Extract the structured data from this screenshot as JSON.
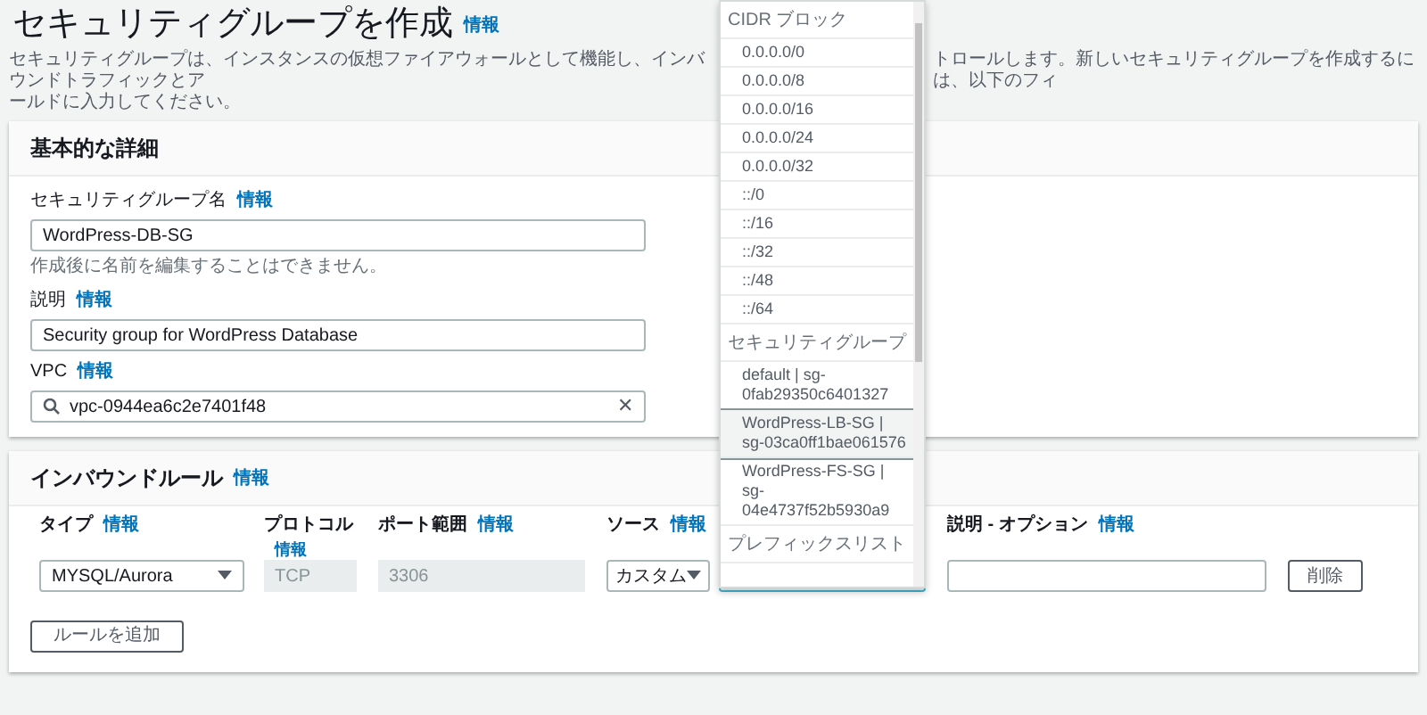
{
  "page": {
    "title": "セキュリティグループを作成",
    "title_info": "情報",
    "description_visible_start": "セキュリティグループは、インスタンスの仮想ファイアウォールとして機能し、インバウンドトラフィックとア",
    "description_visible_end": "トロールします。新しいセキュリティグループを作成するには、以下のフィ",
    "description_line_2": "ールドに入力してください。"
  },
  "basic_details": {
    "heading": "基本的な詳細",
    "fields": [
      {
        "kind": "text",
        "label": "セキュリティグループ名",
        "info": "情報",
        "value": "WordPress-DB-SG",
        "hint": "作成後に名前を編集することはできません。"
      },
      {
        "kind": "text",
        "label": "説明",
        "info": "情報",
        "value": "Security group for WordPress Database"
      },
      {
        "kind": "search",
        "label": "VPC",
        "info": "情報",
        "value": "vpc-0944ea6c2e7401f48",
        "clear": "✕"
      }
    ]
  },
  "inbound_rules": {
    "heading": "インバウンドルール",
    "info": "情報",
    "columns": [
      {
        "label": "タイプ",
        "info": "情報"
      },
      {
        "label": "プロトコル",
        "info": "情報",
        "info_below": true
      },
      {
        "label": "ポート範囲",
        "info": "情報"
      },
      {
        "label": "ソース",
        "info": "情報"
      },
      {
        "label": "説明 - オプション",
        "info": "情報"
      }
    ],
    "rows": [
      {
        "type": "MYSQL/Aurora",
        "protocol": "TCP",
        "port": "3306",
        "source": "カスタム",
        "delete": "削除"
      }
    ],
    "add_button": "ルールを追加"
  },
  "source_dropdown": {
    "groups": [
      {
        "label": "CIDR ブロック",
        "items": [
          {
            "text": "0.0.0.0/0",
            "selected": false
          },
          {
            "text": "0.0.0.0/8",
            "selected": false
          },
          {
            "text": "0.0.0.0/16",
            "selected": false
          },
          {
            "text": "0.0.0.0/24",
            "selected": false
          },
          {
            "text": "0.0.0.0/32",
            "selected": false
          },
          {
            "text": "::/0",
            "selected": false
          },
          {
            "text": "::/16",
            "selected": false
          },
          {
            "text": "::/32",
            "selected": false
          },
          {
            "text": "::/48",
            "selected": false
          },
          {
            "text": "::/64",
            "selected": false
          }
        ]
      },
      {
        "label": "セキュリティグループ",
        "items": [
          {
            "text": "default | sg-0fab29350c6401327",
            "selected": false
          },
          {
            "text": "WordPress-LB-SG | sg-03ca0ff1bae061576",
            "selected": true
          },
          {
            "text": "WordPress-FS-SG | sg-04e4737f52b5930a9",
            "selected": false
          }
        ]
      },
      {
        "label": "プレフィックスリスト"
      }
    ]
  }
}
